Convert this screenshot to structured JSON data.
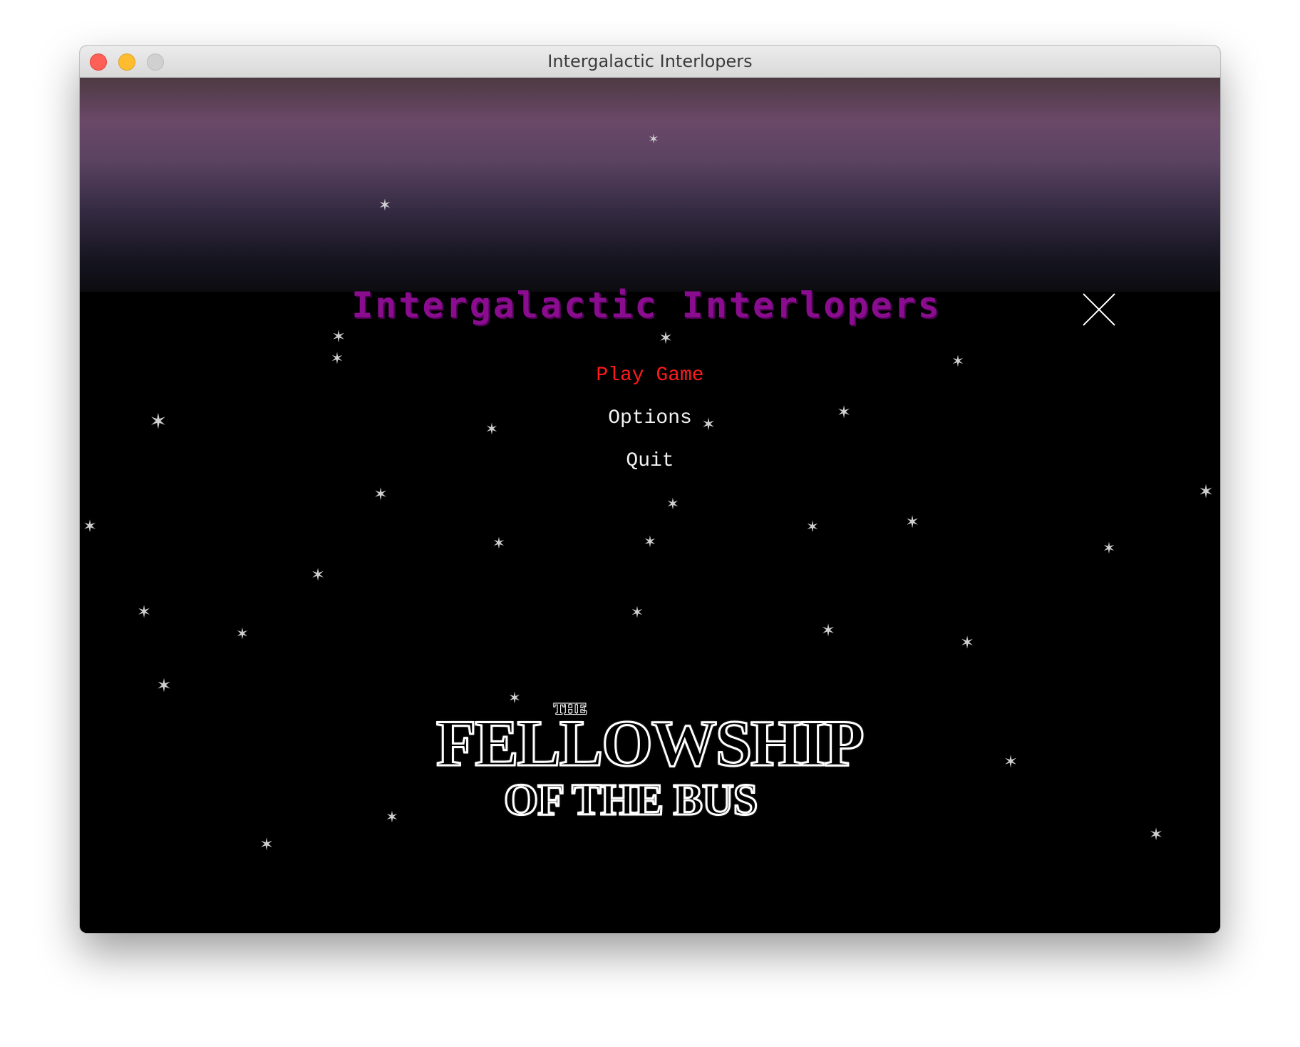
{
  "window": {
    "title": "Intergalactic Interlopers"
  },
  "game": {
    "title": "Intergalactic Interlopers",
    "title_color": "#8a0d8f",
    "menu": {
      "play": "Play Game",
      "options": "Options",
      "quit": "Quit",
      "selected_color": "#ff1a1a",
      "normal_color": "#f2f2f2"
    },
    "logo": {
      "the": "THE",
      "fellowship": "FELLOWSHIP",
      "of_the_bus": "OF THE BUS"
    }
  }
}
